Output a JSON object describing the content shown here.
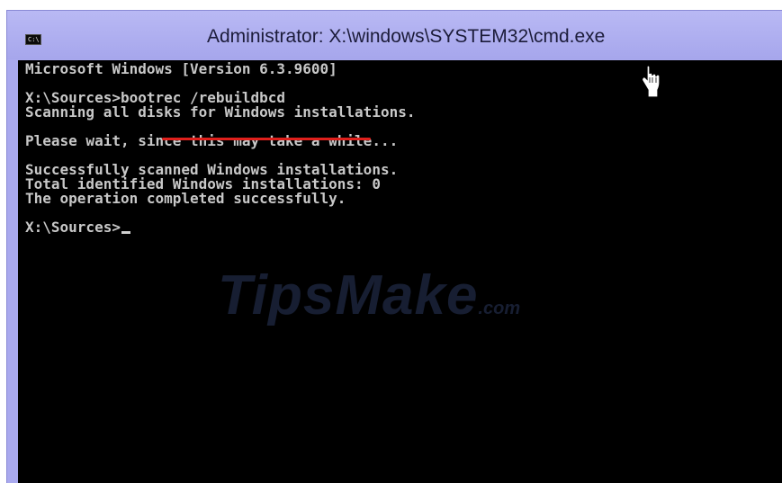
{
  "window": {
    "title": "Administrator: X:\\windows\\SYSTEM32\\cmd.exe",
    "icon": "cmd-icon",
    "icon_text": "C:\\"
  },
  "console": {
    "lines": [
      "Microsoft Windows [Version 6.3.9600]",
      "",
      "X:\\Sources>bootrec /rebuildbcd",
      "Scanning all disks for Windows installations.",
      "",
      "Please wait, since this may take a while...",
      "",
      "Successfully scanned Windows installations.",
      "Total identified Windows installations: 0",
      "The operation completed successfully.",
      "",
      "X:\\Sources>"
    ],
    "highlight_color": "#e0201c"
  },
  "watermark": {
    "main": "TipsMake",
    "suffix": ".com"
  },
  "cursor": {
    "icon": "hand-pointer-icon"
  }
}
